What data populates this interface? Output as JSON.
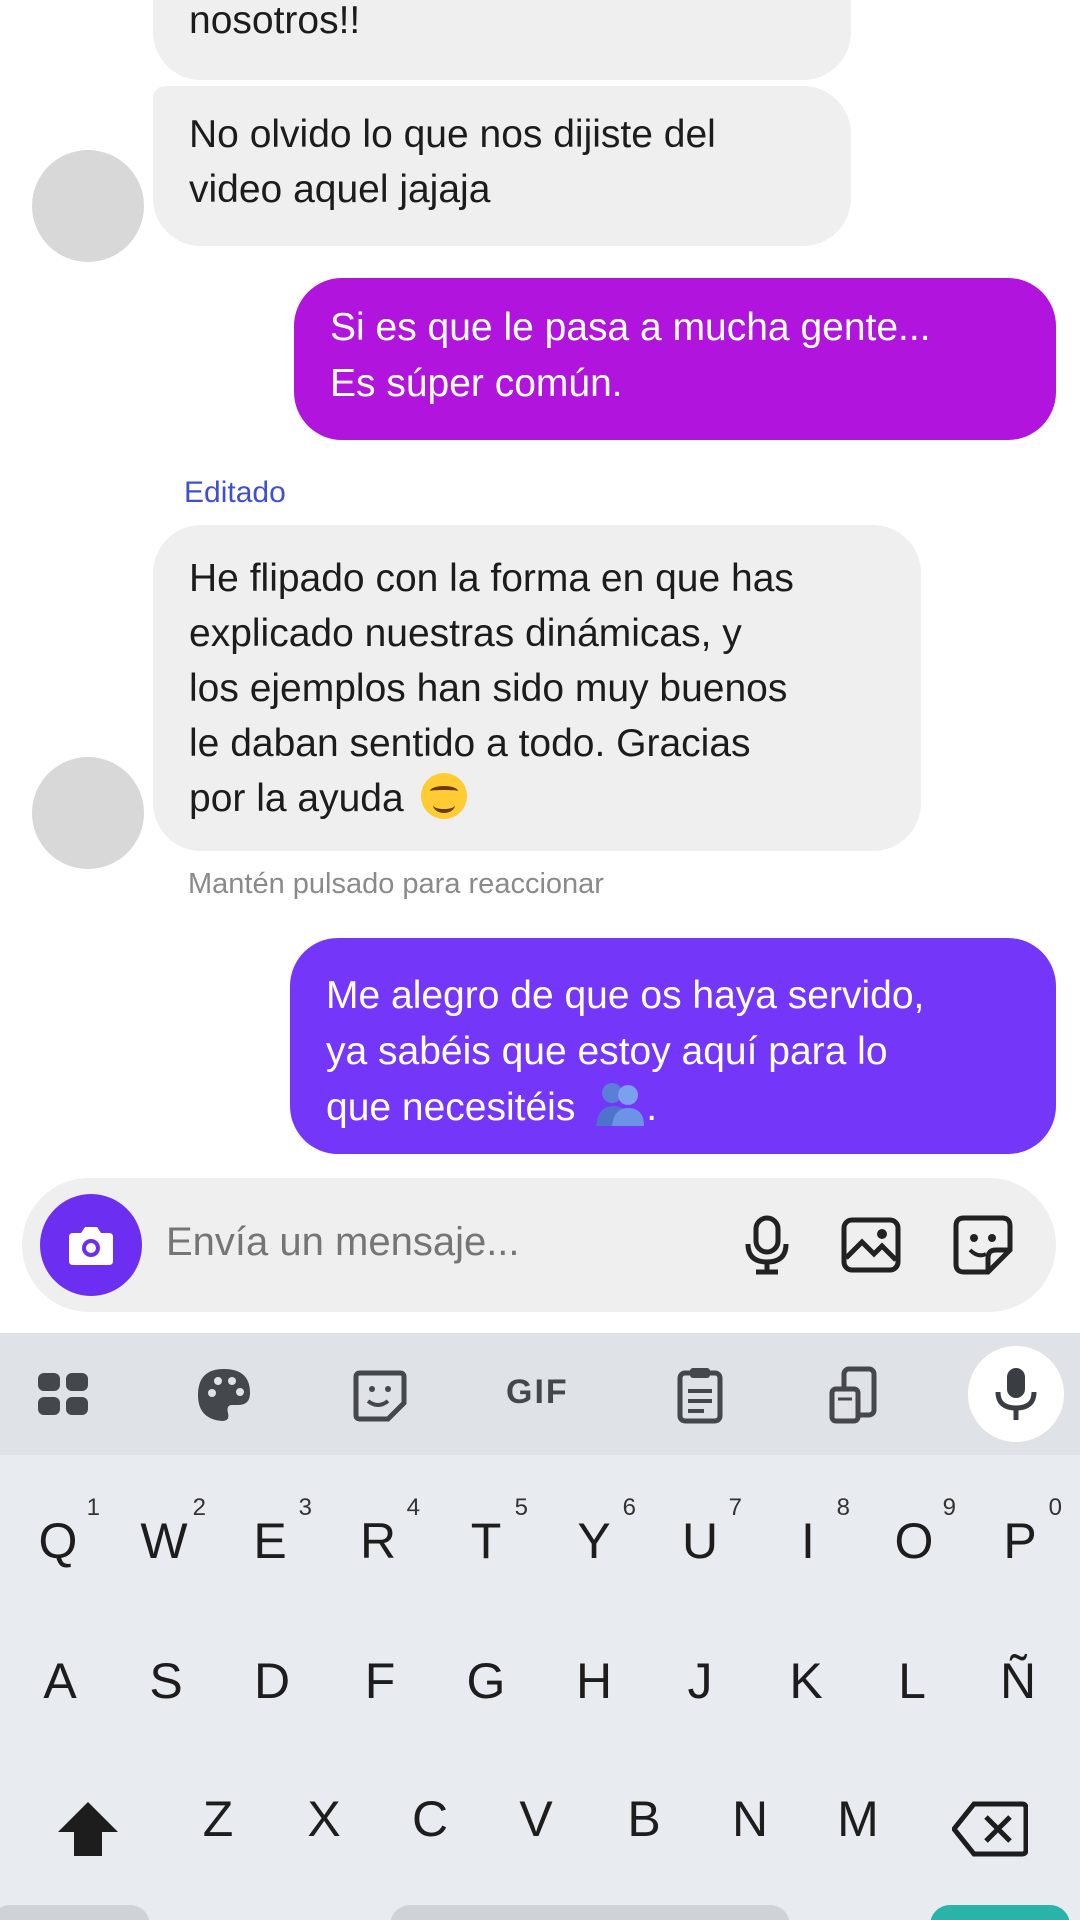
{
  "messages": [
    {
      "direction": "in",
      "text": "nosotros!!"
    },
    {
      "direction": "in",
      "line1": "No olvido lo que nos dijiste del",
      "line2": "video aquel jajaja"
    },
    {
      "direction": "out",
      "line1": "Si es que le pasa a mucha gente...",
      "line2": "Es súper común."
    },
    {
      "direction": "in",
      "label": "Editado",
      "line1": "He flipado con la forma en que has",
      "line2": "explicado nuestras dinámicas, y",
      "line3": "los ejemplos han sido muy buenos",
      "line4": "le daban sentido a todo. Gracias",
      "line5": "por la ayuda",
      "emoji": "smiling-face-icon"
    },
    {
      "direction": "out",
      "line1": "Me alegro de que os haya servido,",
      "line2": "ya sabéis que estoy aquí para lo",
      "line3": "que necesitéis",
      "line3_end": ".",
      "emoji": "people-hugging-icon"
    }
  ],
  "hint": "Mantén pulsado para reaccionar",
  "composer": {
    "placeholder": "Envía un mensaje...",
    "icons": [
      "camera-icon",
      "microphone-icon",
      "image-icon",
      "sticker-icon"
    ]
  },
  "colors": {
    "outgoing_1": "#b014dd",
    "outgoing_2": "#7437f9",
    "incoming": "#efefef",
    "accent": "#6c2ff2",
    "edited_label": "#3e4fcf"
  },
  "keyboard": {
    "toolbar": {
      "gif": "GIF",
      "icons": [
        "apps-grid-icon",
        "palette-icon",
        "sticker-icon",
        "gif-icon",
        "clipboard-icon",
        "phone-translate-icon",
        "microphone-icon"
      ]
    },
    "row1": [
      {
        "key": "Q",
        "num": "1"
      },
      {
        "key": "W",
        "num": "2"
      },
      {
        "key": "E",
        "num": "3"
      },
      {
        "key": "R",
        "num": "4"
      },
      {
        "key": "T",
        "num": "5"
      },
      {
        "key": "Y",
        "num": "6"
      },
      {
        "key": "U",
        "num": "7"
      },
      {
        "key": "I",
        "num": "8"
      },
      {
        "key": "O",
        "num": "9"
      },
      {
        "key": "P",
        "num": "0"
      }
    ],
    "row2": [
      "A",
      "S",
      "D",
      "F",
      "G",
      "H",
      "J",
      "K",
      "L",
      "Ñ"
    ],
    "row3": [
      "Z",
      "X",
      "C",
      "V",
      "B",
      "N",
      "M"
    ]
  }
}
